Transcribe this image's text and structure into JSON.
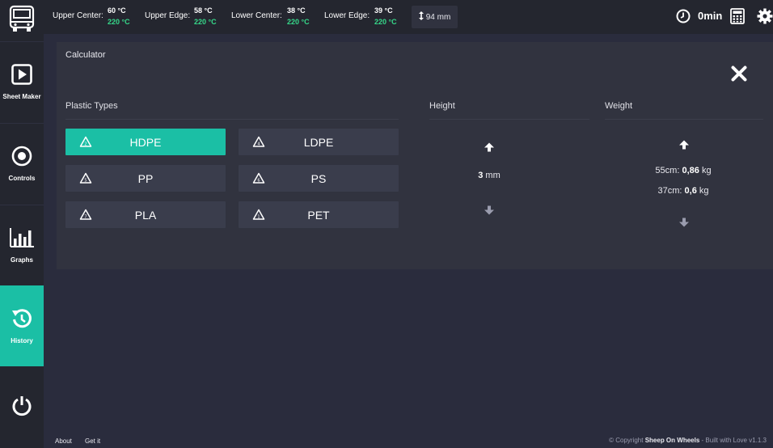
{
  "sidebar": {
    "items": [
      {
        "label": "Sheet Maker",
        "icon": "play-icon"
      },
      {
        "label": "Controls",
        "icon": "target-icon"
      },
      {
        "label": "Graphs",
        "icon": "bar-chart-icon"
      },
      {
        "label": "History",
        "icon": "history-icon",
        "active": true
      }
    ]
  },
  "topbar": {
    "temps": [
      {
        "label": "Upper Center:",
        "current": "60 °C",
        "target": "220 °C"
      },
      {
        "label": "Upper Edge:",
        "current": "58 °C",
        "target": "220 °C"
      },
      {
        "label": "Lower Center:",
        "current": "38 °C",
        "target": "220 °C"
      },
      {
        "label": "Lower Edge:",
        "current": "39 °C",
        "target": "220 °C"
      }
    ],
    "height": "94 mm",
    "timer": "0min"
  },
  "calculator": {
    "title": "Calculator",
    "plastic_types_label": "Plastic Types",
    "height_label": "Height",
    "weight_label": "Weight",
    "types": [
      "HDPE",
      "LDPE",
      "PP",
      "PS",
      "PLA",
      "PET"
    ],
    "selected_type": "HDPE",
    "height_value": "3",
    "height_unit": "mm",
    "weights": [
      {
        "label": "55cm:",
        "value": "0,86",
        "unit": "kg"
      },
      {
        "label": "37cm:",
        "value": "0,6",
        "unit": "kg"
      }
    ]
  },
  "footer": {
    "about": "About",
    "get_it": "Get it",
    "copyright_prefix": "© Copyright",
    "brand": "Sheep On Wheels",
    "copyright_suffix": "- Built with Love v1.1.3"
  },
  "colors": {
    "accent": "#1bbfa5",
    "target_temp": "#36d88a",
    "background": "#2a2c3d",
    "panel": "#31333f"
  }
}
